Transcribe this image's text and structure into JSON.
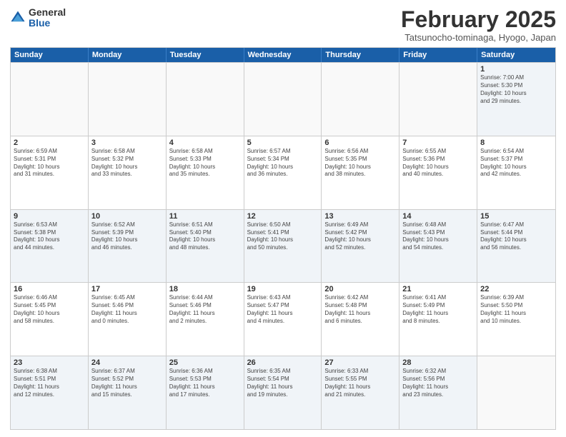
{
  "logo": {
    "general": "General",
    "blue": "Blue"
  },
  "header": {
    "month": "February 2025",
    "location": "Tatsunocho-tominaga, Hyogo, Japan"
  },
  "days": [
    "Sunday",
    "Monday",
    "Tuesday",
    "Wednesday",
    "Thursday",
    "Friday",
    "Saturday"
  ],
  "rows": [
    [
      {
        "day": "",
        "text": ""
      },
      {
        "day": "",
        "text": ""
      },
      {
        "day": "",
        "text": ""
      },
      {
        "day": "",
        "text": ""
      },
      {
        "day": "",
        "text": ""
      },
      {
        "day": "",
        "text": ""
      },
      {
        "day": "1",
        "text": "Sunrise: 7:00 AM\nSunset: 5:30 PM\nDaylight: 10 hours\nand 29 minutes."
      }
    ],
    [
      {
        "day": "2",
        "text": "Sunrise: 6:59 AM\nSunset: 5:31 PM\nDaylight: 10 hours\nand 31 minutes."
      },
      {
        "day": "3",
        "text": "Sunrise: 6:58 AM\nSunset: 5:32 PM\nDaylight: 10 hours\nand 33 minutes."
      },
      {
        "day": "4",
        "text": "Sunrise: 6:58 AM\nSunset: 5:33 PM\nDaylight: 10 hours\nand 35 minutes."
      },
      {
        "day": "5",
        "text": "Sunrise: 6:57 AM\nSunset: 5:34 PM\nDaylight: 10 hours\nand 36 minutes."
      },
      {
        "day": "6",
        "text": "Sunrise: 6:56 AM\nSunset: 5:35 PM\nDaylight: 10 hours\nand 38 minutes."
      },
      {
        "day": "7",
        "text": "Sunrise: 6:55 AM\nSunset: 5:36 PM\nDaylight: 10 hours\nand 40 minutes."
      },
      {
        "day": "8",
        "text": "Sunrise: 6:54 AM\nSunset: 5:37 PM\nDaylight: 10 hours\nand 42 minutes."
      }
    ],
    [
      {
        "day": "9",
        "text": "Sunrise: 6:53 AM\nSunset: 5:38 PM\nDaylight: 10 hours\nand 44 minutes."
      },
      {
        "day": "10",
        "text": "Sunrise: 6:52 AM\nSunset: 5:39 PM\nDaylight: 10 hours\nand 46 minutes."
      },
      {
        "day": "11",
        "text": "Sunrise: 6:51 AM\nSunset: 5:40 PM\nDaylight: 10 hours\nand 48 minutes."
      },
      {
        "day": "12",
        "text": "Sunrise: 6:50 AM\nSunset: 5:41 PM\nDaylight: 10 hours\nand 50 minutes."
      },
      {
        "day": "13",
        "text": "Sunrise: 6:49 AM\nSunset: 5:42 PM\nDaylight: 10 hours\nand 52 minutes."
      },
      {
        "day": "14",
        "text": "Sunrise: 6:48 AM\nSunset: 5:43 PM\nDaylight: 10 hours\nand 54 minutes."
      },
      {
        "day": "15",
        "text": "Sunrise: 6:47 AM\nSunset: 5:44 PM\nDaylight: 10 hours\nand 56 minutes."
      }
    ],
    [
      {
        "day": "16",
        "text": "Sunrise: 6:46 AM\nSunset: 5:45 PM\nDaylight: 10 hours\nand 58 minutes."
      },
      {
        "day": "17",
        "text": "Sunrise: 6:45 AM\nSunset: 5:46 PM\nDaylight: 11 hours\nand 0 minutes."
      },
      {
        "day": "18",
        "text": "Sunrise: 6:44 AM\nSunset: 5:46 PM\nDaylight: 11 hours\nand 2 minutes."
      },
      {
        "day": "19",
        "text": "Sunrise: 6:43 AM\nSunset: 5:47 PM\nDaylight: 11 hours\nand 4 minutes."
      },
      {
        "day": "20",
        "text": "Sunrise: 6:42 AM\nSunset: 5:48 PM\nDaylight: 11 hours\nand 6 minutes."
      },
      {
        "day": "21",
        "text": "Sunrise: 6:41 AM\nSunset: 5:49 PM\nDaylight: 11 hours\nand 8 minutes."
      },
      {
        "day": "22",
        "text": "Sunrise: 6:39 AM\nSunset: 5:50 PM\nDaylight: 11 hours\nand 10 minutes."
      }
    ],
    [
      {
        "day": "23",
        "text": "Sunrise: 6:38 AM\nSunset: 5:51 PM\nDaylight: 11 hours\nand 12 minutes."
      },
      {
        "day": "24",
        "text": "Sunrise: 6:37 AM\nSunset: 5:52 PM\nDaylight: 11 hours\nand 15 minutes."
      },
      {
        "day": "25",
        "text": "Sunrise: 6:36 AM\nSunset: 5:53 PM\nDaylight: 11 hours\nand 17 minutes."
      },
      {
        "day": "26",
        "text": "Sunrise: 6:35 AM\nSunset: 5:54 PM\nDaylight: 11 hours\nand 19 minutes."
      },
      {
        "day": "27",
        "text": "Sunrise: 6:33 AM\nSunset: 5:55 PM\nDaylight: 11 hours\nand 21 minutes."
      },
      {
        "day": "28",
        "text": "Sunrise: 6:32 AM\nSunset: 5:56 PM\nDaylight: 11 hours\nand 23 minutes."
      },
      {
        "day": "",
        "text": ""
      }
    ]
  ]
}
